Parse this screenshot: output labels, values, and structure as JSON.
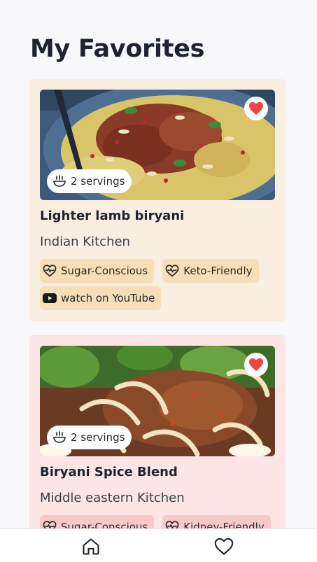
{
  "page": {
    "title": "My Favorites"
  },
  "recipes": [
    {
      "title": "Lighter lamb biryani",
      "kitchen": "Indian Kitchen",
      "servings": "2 servings",
      "card_color": "#faeee1",
      "tags": [
        {
          "label": "Sugar-Conscious",
          "icon": "heart-pulse-icon"
        },
        {
          "label": "Keto-Friendly",
          "icon": "heart-pulse-icon"
        },
        {
          "label": "watch on YouTube",
          "icon": "youtube-icon"
        }
      ]
    },
    {
      "title": "Biryani Spice Blend",
      "kitchen": "Middle eastern Kitchen",
      "servings": "2 servings",
      "card_color": "#fde4e5",
      "tags": [
        {
          "label": "Sugar-Conscious",
          "icon": "heart-pulse-icon"
        },
        {
          "label": "Kidney-Friendly",
          "icon": "heart-pulse-icon"
        }
      ]
    }
  ],
  "colors": {
    "favorite_red": "#ef4444",
    "text": "#1f2230"
  },
  "nav": {
    "items": [
      "home-icon",
      "heart-icon"
    ]
  }
}
